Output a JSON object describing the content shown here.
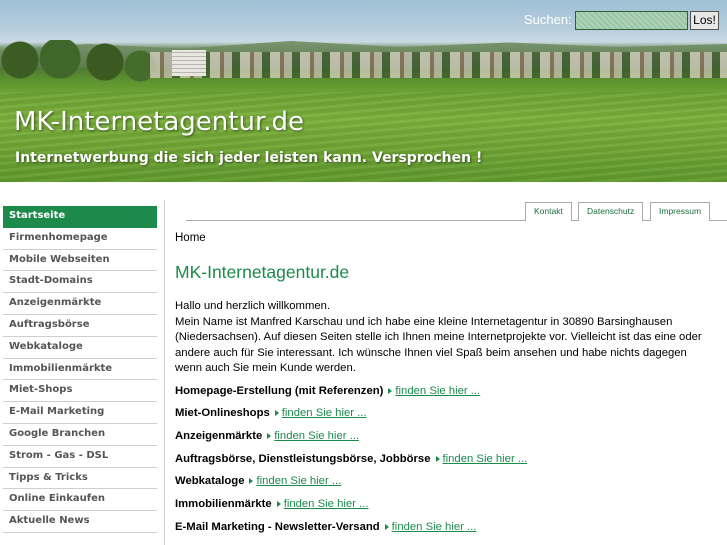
{
  "header": {
    "site_title": "MK-Internetagentur.de",
    "slogan": "Internetwerbung die sich jeder leisten kann. Versprochen !",
    "search_label": "Suchen:",
    "search_value": "",
    "search_button": "Los!"
  },
  "sidebar": {
    "items": [
      {
        "label": "Startseite",
        "active": true
      },
      {
        "label": "Firmenhomepage"
      },
      {
        "label": "Mobile Webseiten"
      },
      {
        "label": "Stadt-Domains"
      },
      {
        "label": "Anzeigenmärkte"
      },
      {
        "label": "Auftragsbörse"
      },
      {
        "label": "Webkataloge"
      },
      {
        "label": "Immobilienmärkte"
      },
      {
        "label": "Miet-Shops"
      },
      {
        "label": "E-Mail Marketing"
      },
      {
        "label": "Google Branchen"
      },
      {
        "label": "Strom - Gas - DSL"
      },
      {
        "label": "Tipps & Tricks"
      },
      {
        "label": "Online Einkaufen"
      },
      {
        "label": "Aktuelle News"
      }
    ]
  },
  "top_links": [
    "Kontakt",
    "Datenschutz",
    "Impressum"
  ],
  "main": {
    "breadcrumb": "Home",
    "title": "MK-Internetagentur.de",
    "greeting": "Hallo und herzlich willkommen.",
    "intro": "Mein Name ist Manfred Karschau und ich habe eine kleine Internetagentur in 30890 Barsinghausen (Niedersachsen). Auf diesen Seiten stelle ich Ihnen meine Internetprojekte vor. Vielleicht ist das eine oder andere auch für Sie interessant. Ich wünsche Ihnen viel Spaß beim ansehen und habe nichts dagegen wenn auch Sie mein Kunde werden.",
    "features": [
      {
        "name": "Homepage-Erstellung (mit Referenzen)",
        "link": "finden Sie hier ..."
      },
      {
        "name": "Miet-Onlineshops",
        "link": "finden Sie hier ..."
      },
      {
        "name": "Anzeigenmärkte",
        "link": "finden Sie hier ..."
      },
      {
        "name": "Auftragsbörse, Dienstleistungsbörse, Jobbörse",
        "link": "finden Sie hier ..."
      },
      {
        "name": "Webkataloge",
        "link": "finden Sie hier ..."
      },
      {
        "name": "Immobilienmärkte",
        "link": "finden Sie hier ..."
      },
      {
        "name": "E-Mail Marketing - Newsletter-Versand",
        "link": "finden Sie hier ..."
      }
    ]
  },
  "colors": {
    "accent": "#1b8a4b",
    "link": "#1b8a4b"
  }
}
